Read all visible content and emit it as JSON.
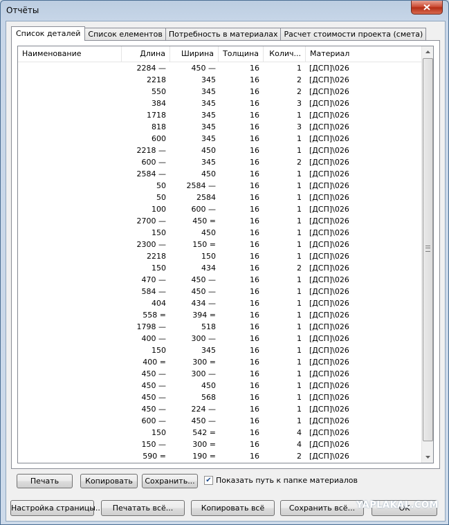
{
  "window": {
    "title": "Отчёты"
  },
  "tabs": [
    {
      "label": "Список деталей",
      "active": true
    },
    {
      "label": "Список елементов",
      "active": false
    },
    {
      "label": "Потребность в материалах",
      "active": false
    },
    {
      "label": "Расчет стоимости проекта (смета)",
      "active": false
    }
  ],
  "table": {
    "columns": {
      "name": "Наименование",
      "length": "Длина",
      "width": "Ширина",
      "thickness": "Толщина",
      "quantity": "Колич...",
      "material": "Материал"
    },
    "rows": [
      {
        "length": "2284 —",
        "width": "450 —",
        "thickness": "16",
        "quantity": "1",
        "material": "[ДСП]\\026"
      },
      {
        "length": "2218",
        "width": "345",
        "thickness": "16",
        "quantity": "2",
        "material": "[ДСП]\\026"
      },
      {
        "length": "550",
        "width": "345",
        "thickness": "16",
        "quantity": "2",
        "material": "[ДСП]\\026"
      },
      {
        "length": "384",
        "width": "345",
        "thickness": "16",
        "quantity": "3",
        "material": "[ДСП]\\026"
      },
      {
        "length": "1718",
        "width": "345",
        "thickness": "16",
        "quantity": "1",
        "material": "[ДСП]\\026"
      },
      {
        "length": "818",
        "width": "345",
        "thickness": "16",
        "quantity": "3",
        "material": "[ДСП]\\026"
      },
      {
        "length": "600",
        "width": "345",
        "thickness": "16",
        "quantity": "1",
        "material": "[ДСП]\\026"
      },
      {
        "length": "2218 —",
        "width": "450",
        "thickness": "16",
        "quantity": "1",
        "material": "[ДСП]\\026"
      },
      {
        "length": "600 —",
        "width": "345",
        "thickness": "16",
        "quantity": "2",
        "material": "[ДСП]\\026"
      },
      {
        "length": "2584 —",
        "width": "450",
        "thickness": "16",
        "quantity": "1",
        "material": "[ДСП]\\026"
      },
      {
        "length": "50",
        "width": "2584 —",
        "thickness": "16",
        "quantity": "1",
        "material": "[ДСП]\\026"
      },
      {
        "length": "50",
        "width": "2584",
        "thickness": "16",
        "quantity": "1",
        "material": "[ДСП]\\026"
      },
      {
        "length": "100",
        "width": "600 —",
        "thickness": "16",
        "quantity": "1",
        "material": "[ДСП]\\026"
      },
      {
        "length": "2700 —",
        "width": "450 =",
        "thickness": "16",
        "quantity": "1",
        "material": "[ДСП]\\026"
      },
      {
        "length": "150",
        "width": "450",
        "thickness": "16",
        "quantity": "1",
        "material": "[ДСП]\\026"
      },
      {
        "length": "2300 —",
        "width": "150 =",
        "thickness": "16",
        "quantity": "1",
        "material": "[ДСП]\\026"
      },
      {
        "length": "2218",
        "width": "150",
        "thickness": "16",
        "quantity": "1",
        "material": "[ДСП]\\026"
      },
      {
        "length": "150",
        "width": "434",
        "thickness": "16",
        "quantity": "2",
        "material": "[ДСП]\\026"
      },
      {
        "length": "470 —",
        "width": "450 —",
        "thickness": "16",
        "quantity": "1",
        "material": "[ДСП]\\026"
      },
      {
        "length": "584 —",
        "width": "450 —",
        "thickness": "16",
        "quantity": "1",
        "material": "[ДСП]\\026"
      },
      {
        "length": "404",
        "width": "434 —",
        "thickness": "16",
        "quantity": "1",
        "material": "[ДСП]\\026"
      },
      {
        "length": "558 =",
        "width": "394 =",
        "thickness": "16",
        "quantity": "1",
        "material": "[ДСП]\\026"
      },
      {
        "length": "1798 —",
        "width": "518",
        "thickness": "16",
        "quantity": "1",
        "material": "[ДСП]\\026"
      },
      {
        "length": "400 —",
        "width": "300 —",
        "thickness": "16",
        "quantity": "1",
        "material": "[ДСП]\\026"
      },
      {
        "length": "150",
        "width": "345",
        "thickness": "16",
        "quantity": "1",
        "material": "[ДСП]\\026"
      },
      {
        "length": "400 =",
        "width": "300 =",
        "thickness": "16",
        "quantity": "1",
        "material": "[ДСП]\\026"
      },
      {
        "length": "450 —",
        "width": "300 —",
        "thickness": "16",
        "quantity": "1",
        "material": "[ДСП]\\026"
      },
      {
        "length": "450 —",
        "width": "450",
        "thickness": "16",
        "quantity": "1",
        "material": "[ДСП]\\026"
      },
      {
        "length": "450 —",
        "width": "568",
        "thickness": "16",
        "quantity": "1",
        "material": "[ДСП]\\026"
      },
      {
        "length": "450 —",
        "width": "224 —",
        "thickness": "16",
        "quantity": "1",
        "material": "[ДСП]\\026"
      },
      {
        "length": "600 —",
        "width": "450 —",
        "thickness": "16",
        "quantity": "1",
        "material": "[ДСП]\\026"
      },
      {
        "length": "150",
        "width": "542 =",
        "thickness": "16",
        "quantity": "4",
        "material": "[ДСП]\\026"
      },
      {
        "length": "150 —",
        "width": "300 =",
        "thickness": "16",
        "quantity": "4",
        "material": "[ДСП]\\026"
      },
      {
        "length": "590 =",
        "width": "190 =",
        "thickness": "16",
        "quantity": "2",
        "material": "[ДСП]\\026"
      }
    ]
  },
  "panel_actions": {
    "print": "Печать",
    "copy": "Копировать",
    "save": "Сохранить...",
    "show_path_label": "Показать путь к папке материалов",
    "show_path_checked": true
  },
  "footer": {
    "page_setup": "Настройка страницы...",
    "print_all": "Печатать всё...",
    "copy_all": "Копировать всё",
    "save_all": "Сохранить всё...",
    "ok": "OK"
  },
  "watermark": "YAPLAKAL.COM",
  "icons": {
    "close": "close-icon",
    "check": "checkmark-icon",
    "scroll_up": "scroll-up-icon",
    "scroll_down": "scroll-down-icon"
  }
}
